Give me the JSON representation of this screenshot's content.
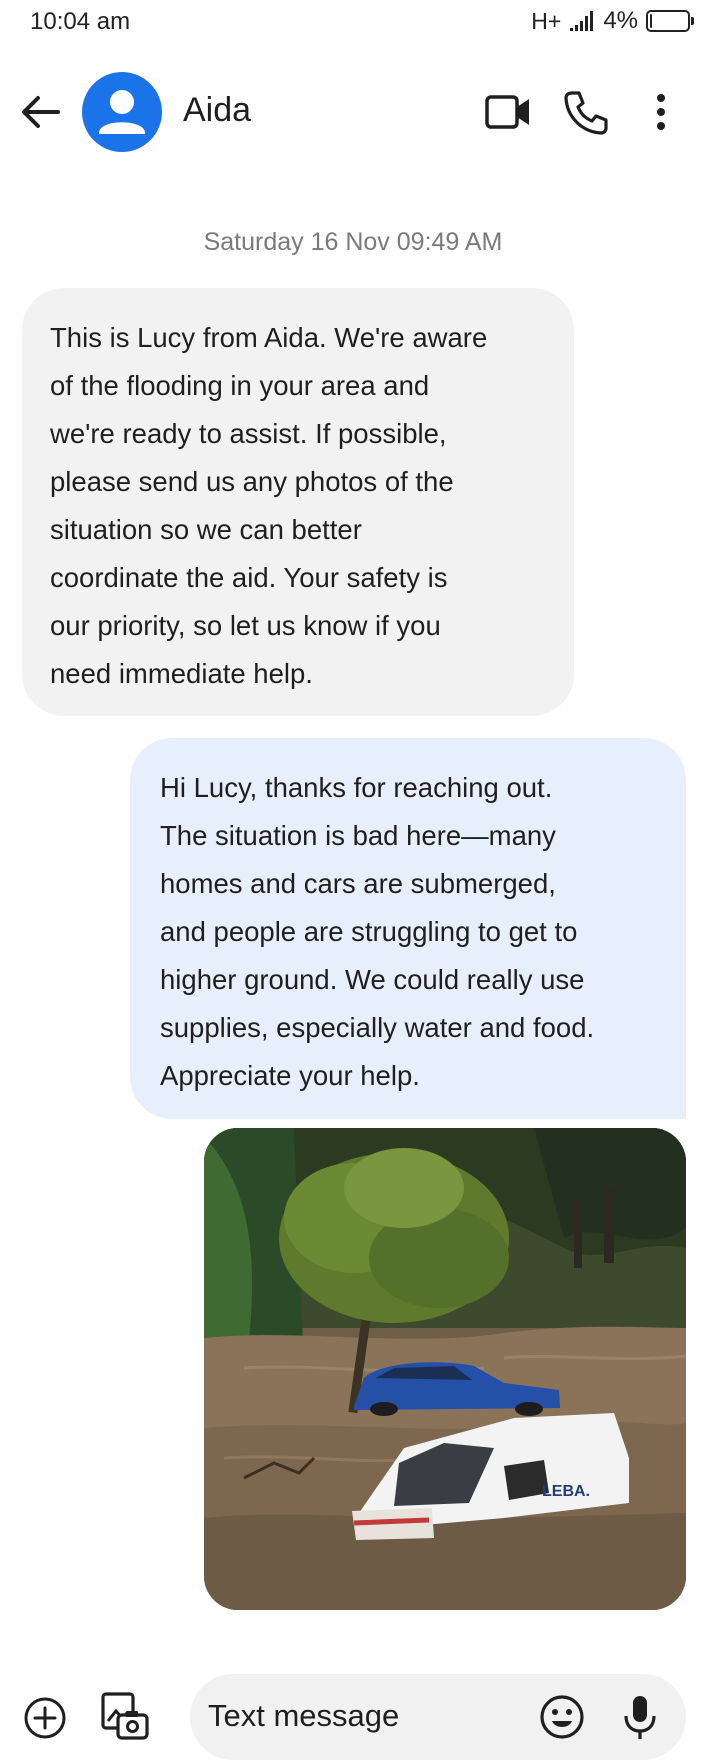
{
  "status_bar": {
    "time": "10:04 am",
    "network": "H+",
    "battery_percent_label": "4%",
    "battery_level": 0.04,
    "icons": [
      "signal-icon",
      "battery-icon"
    ]
  },
  "header": {
    "contact_name": "Aida",
    "avatar_color": "#1a73e8",
    "icons": [
      "back-arrow-icon",
      "person-icon",
      "video-call-icon",
      "phone-icon",
      "more-vert-icon"
    ]
  },
  "conversation": {
    "date_separator": "Saturday 16 Nov 09:49 AM",
    "messages": [
      {
        "direction": "incoming",
        "text": "This is Lucy from Aida. We're aware\nof the flooding in your area and\nwe're ready to assist. If possible,\nplease send us any photos of the\nsituation so we can better\ncoordinate the aid. Your safety is\nour priority, so let us know if you\nneed immediate help."
      },
      {
        "direction": "outgoing",
        "text": "Hi Lucy, thanks for reaching out.\nThe situation is bad here—many\nhomes and cars are submerged,\nand people are struggling to get to\nhigher ground. We could really use\nsupplies, especially water and food.\nAppreciate your help."
      },
      {
        "direction": "outgoing",
        "type": "photo",
        "van_lettering": "LEBA."
      }
    ]
  },
  "composer": {
    "placeholder": "Text message",
    "value": "",
    "icons": [
      "add-icon",
      "gallery-camera-icon",
      "emoji-icon",
      "mic-icon"
    ]
  },
  "colors": {
    "incoming_bubble": "#f2f2f2",
    "outgoing_bubble": "#e7eefc",
    "composer_bg": "#f1f1f1",
    "date_text": "#7a7a7a"
  }
}
